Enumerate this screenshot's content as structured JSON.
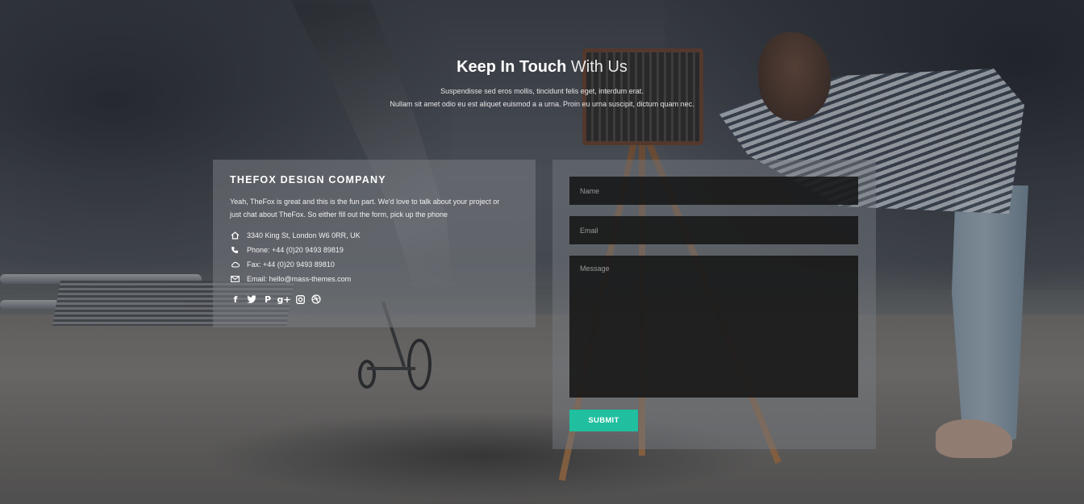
{
  "heading": {
    "strong": "Keep In Touch",
    "light": " With Us",
    "subtitle_line1": "Suspendisse sed eros mollis, tincidunt felis eget, interdum erat.",
    "subtitle_line2": "Nullam sit amet odio eu est aliquet euismod a a urna. Proin eu urna suscipit, dictum quam nec."
  },
  "info": {
    "company": "THEFOX DESIGN COMPANY",
    "description": "Yeah, TheFox is great and this is the fun part. We'd love to talk about your project or just chat about TheFox. So either fill out the form, pick up the phone",
    "contacts": [
      {
        "icon": "home-icon",
        "text": "3340 King St, London W6 0RR, UK"
      },
      {
        "icon": "phone-icon",
        "text": "Phone: +44 (0)20 9493 89819"
      },
      {
        "icon": "cloud-icon",
        "text": "Fax: +44 (0)20 9493 89810"
      },
      {
        "icon": "envelope-icon",
        "text": "Email: hello@mass-themes.com"
      }
    ],
    "social": [
      {
        "icon": "facebook-icon",
        "glyph": "f"
      },
      {
        "icon": "twitter-icon",
        "glyph": "t"
      },
      {
        "icon": "pinterest-icon",
        "glyph": "P"
      },
      {
        "icon": "google-plus-icon",
        "glyph": "g+"
      },
      {
        "icon": "instagram-icon",
        "glyph": "◙"
      },
      {
        "icon": "dribbble-icon",
        "glyph": "⊛"
      }
    ]
  },
  "form": {
    "name_placeholder": "Name",
    "email_placeholder": "Email",
    "message_placeholder": "Message",
    "submit_label": "SUBMIT"
  },
  "colors": {
    "accent": "#1fbf9f",
    "field_bg": "#161616",
    "panel_bg": "#787c82"
  }
}
